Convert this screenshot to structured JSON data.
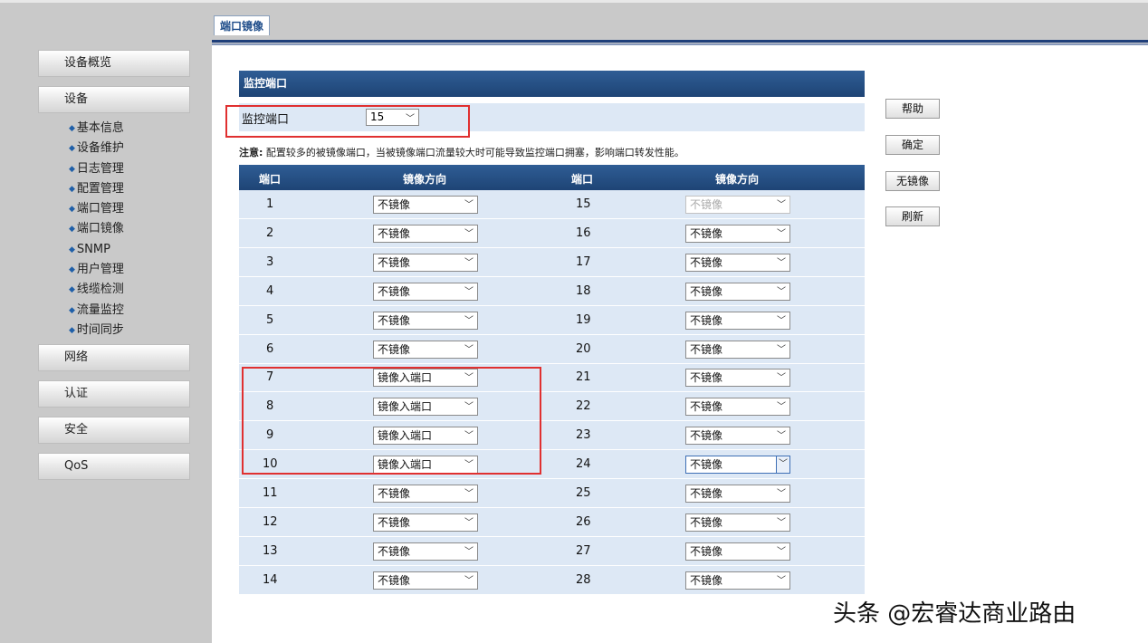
{
  "header": {
    "tab_label": "端口镜像"
  },
  "sidebar": {
    "menu_overview": "设备概览",
    "menu_device": "设备",
    "submenu": [
      "基本信息",
      "设备维护",
      "日志管理",
      "配置管理",
      "端口管理",
      "端口镜像",
      "SNMP",
      "用户管理",
      "线缆检测",
      "流量监控",
      "时间同步"
    ],
    "menu_network": "网络",
    "menu_auth": "认证",
    "menu_security": "安全",
    "menu_qos": "QoS"
  },
  "section": {
    "title": "监控端口",
    "monitor_label": "监控端口",
    "monitor_value": "15",
    "note_prefix": "注意:",
    "note_text": "配置较多的被镜像端口，当被镜像端口流量较大时可能导致监控端口拥塞，影响端口转发性能。"
  },
  "grid": {
    "col_port_left": "端口",
    "col_dir_left": "镜像方向",
    "col_port_right": "端口",
    "col_dir_right": "镜像方向",
    "rows": [
      {
        "p1": "1",
        "d1": "不镜像",
        "p2": "15",
        "d2": "不镜像"
      },
      {
        "p1": "2",
        "d1": "不镜像",
        "p2": "16",
        "d2": "不镜像"
      },
      {
        "p1": "3",
        "d1": "不镜像",
        "p2": "17",
        "d2": "不镜像"
      },
      {
        "p1": "4",
        "d1": "不镜像",
        "p2": "18",
        "d2": "不镜像"
      },
      {
        "p1": "5",
        "d1": "不镜像",
        "p2": "19",
        "d2": "不镜像"
      },
      {
        "p1": "6",
        "d1": "不镜像",
        "p2": "20",
        "d2": "不镜像"
      },
      {
        "p1": "7",
        "d1": "镜像入端口",
        "p2": "21",
        "d2": "不镜像"
      },
      {
        "p1": "8",
        "d1": "镜像入端口",
        "p2": "22",
        "d2": "不镜像"
      },
      {
        "p1": "9",
        "d1": "镜像入端口",
        "p2": "23",
        "d2": "不镜像"
      },
      {
        "p1": "10",
        "d1": "镜像入端口",
        "p2": "24",
        "d2": "不镜像"
      },
      {
        "p1": "11",
        "d1": "不镜像",
        "p2": "25",
        "d2": "不镜像"
      },
      {
        "p1": "12",
        "d1": "不镜像",
        "p2": "26",
        "d2": "不镜像"
      },
      {
        "p1": "13",
        "d1": "不镜像",
        "p2": "27",
        "d2": "不镜像"
      },
      {
        "p1": "14",
        "d1": "不镜像",
        "p2": "28",
        "d2": "不镜像"
      }
    ]
  },
  "actions": {
    "help": "帮助",
    "confirm": "确定",
    "no_mirror": "无镜像",
    "refresh": "刷新"
  },
  "watermark": "头条 @宏睿达商业路由",
  "colors": {
    "header_blue": "#1e4475",
    "row_bg": "#dde8f5",
    "highlight_red": "#e03030"
  }
}
